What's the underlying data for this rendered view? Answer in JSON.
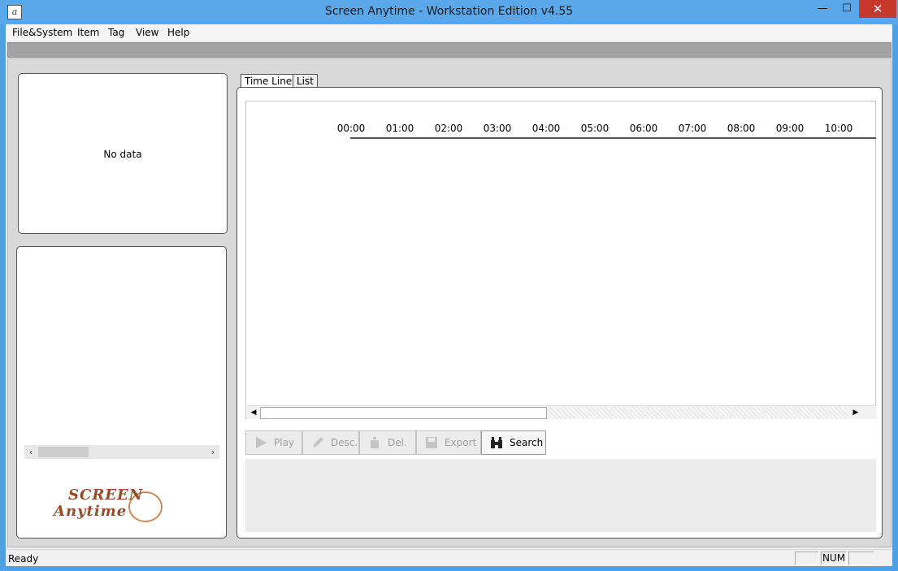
{
  "window": {
    "title": "Screen Anytime - Workstation Edition v4.55",
    "min_glyph": "—",
    "max_glyph": "☐",
    "close_glyph": "✕",
    "icon": "app-icon"
  },
  "menu": {
    "items": [
      "File&System",
      "Item",
      "Tag",
      "View",
      "Help"
    ]
  },
  "preview": {
    "empty_text": "No data"
  },
  "logo": {
    "line1": "SCREEN",
    "line2": "Anytime"
  },
  "tabs": [
    {
      "label": "Time Line",
      "selected": true
    },
    {
      "label": "List",
      "selected": false
    }
  ],
  "timeline": {
    "hours": [
      "00:00",
      "01:00",
      "02:00",
      "03:00",
      "04:00",
      "05:00",
      "06:00",
      "07:00",
      "08:00",
      "09:00",
      "10:00"
    ]
  },
  "actions": [
    {
      "label": "Play",
      "icon": "play-icon",
      "enabled": false
    },
    {
      "label": "Desc.",
      "icon": "pencil-icon",
      "enabled": false
    },
    {
      "label": "Del.",
      "icon": "trash-icon",
      "enabled": false
    },
    {
      "label": "Export",
      "icon": "floppy-icon",
      "enabled": false
    },
    {
      "label": "Search",
      "icon": "binoculars-icon",
      "enabled": true
    }
  ],
  "status": {
    "text": "Ready",
    "num": "NUM"
  }
}
